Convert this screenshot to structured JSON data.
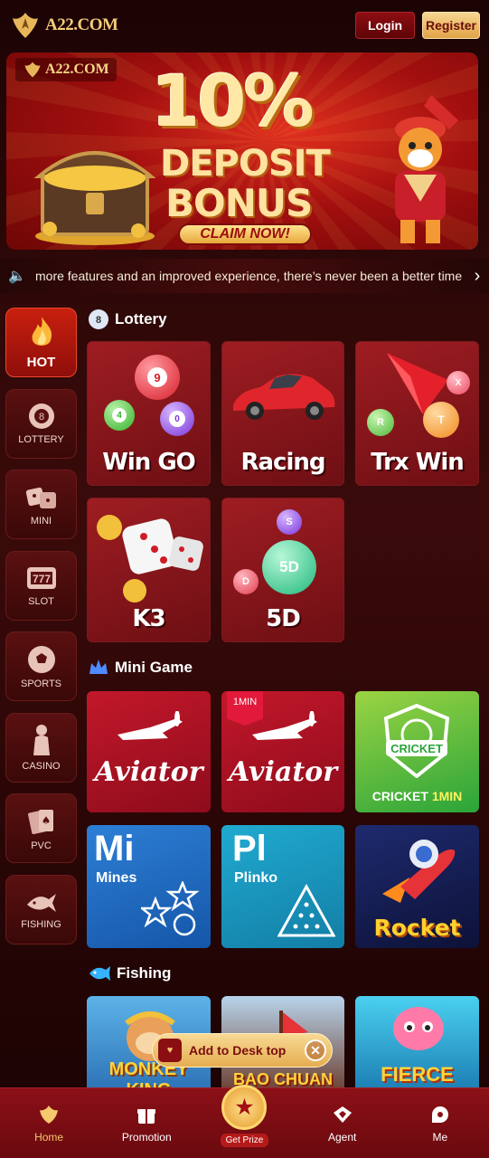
{
  "header": {
    "logo_text": "A22.COM",
    "login_label": "Login",
    "register_label": "Register"
  },
  "banner": {
    "logo_text": "A22.COM",
    "headline": "10%",
    "line1": "DEPOSIT",
    "line2": "BONUS",
    "cta": "CLAIM NOW!"
  },
  "marquee": {
    "text": "more features and an improved experience, there’s never been a better time"
  },
  "left_nav": [
    {
      "label": "HOT",
      "icon": "flame-icon",
      "active": true
    },
    {
      "label": "LOTTERY",
      "icon": "lottery-ball-icon"
    },
    {
      "label": "MINI",
      "icon": "dice-icon"
    },
    {
      "label": "SLOT",
      "icon": "slot-777-icon"
    },
    {
      "label": "SPORTS",
      "icon": "soccer-ball-icon"
    },
    {
      "label": "CASINO",
      "icon": "casino-girl-icon"
    },
    {
      "label": "PVC",
      "icon": "cards-icon"
    },
    {
      "label": "FISHING",
      "icon": "shark-icon"
    }
  ],
  "sections": {
    "lottery": "Lottery",
    "mini_game": "Mini Game",
    "fishing": "Fishing"
  },
  "lottery": [
    {
      "name": "Win GO"
    },
    {
      "name": "Racing"
    },
    {
      "name": "Trx Win"
    },
    {
      "name": "K3"
    },
    {
      "name": "5D"
    }
  ],
  "lottery_balls": {
    "wingo": [
      "9",
      "4",
      "0"
    ],
    "trx": [
      "X",
      "R",
      "T"
    ],
    "fived": [
      "5D",
      "D",
      "S"
    ]
  },
  "mini_games": {
    "aviator": "Aviator",
    "aviator_1min": "Aviator",
    "tag_1min": "1MIN",
    "cricket_logo": "CRICKET",
    "cricket_label": "CRICKET",
    "cricket_suffix": "1MIN",
    "mines_abbr": "Mi",
    "mines_name": "Mines",
    "plinko_abbr": "Pl",
    "plinko_name": "Plinko",
    "rocket": "Rocket"
  },
  "fishing": [
    "MONKEY KING",
    "BAO CHUAN",
    "FIERCE"
  ],
  "add_to_desk": {
    "label": "Add to Desk top"
  },
  "bottom_nav": [
    {
      "label": "Home",
      "active": true
    },
    {
      "label": "Promotion"
    },
    {
      "label": "Get Prize"
    },
    {
      "label": "Agent"
    },
    {
      "label": "Me"
    }
  ],
  "colors": {
    "accent_gold": "#f3cc7a",
    "brand_red": "#8b1017",
    "active_nav": "#c8200e"
  }
}
